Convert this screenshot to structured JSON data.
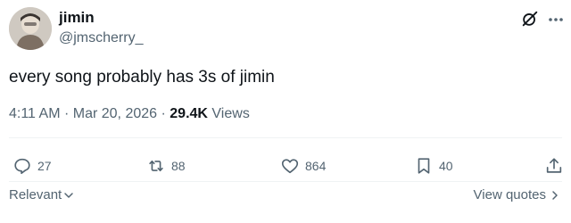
{
  "author": {
    "display_name": "jimin",
    "handle": "@jmscherry_",
    "avatar_icon": "profile-photo"
  },
  "tweet": {
    "text": "every song probably has 3s of jimin"
  },
  "meta": {
    "time": "4:11 AM",
    "separator1": "·",
    "date": "Mar 20, 2026",
    "separator2": "·",
    "views_count": "29.4K",
    "views_label": "Views"
  },
  "actions": {
    "replies": "27",
    "reposts": "88",
    "likes": "864",
    "bookmarks": "40"
  },
  "footer": {
    "sort_label": "Relevant",
    "view_quotes_label": "View quotes"
  },
  "colors": {
    "text_primary": "#0f1419",
    "text_secondary": "#536471",
    "divider": "#eff3f4"
  }
}
